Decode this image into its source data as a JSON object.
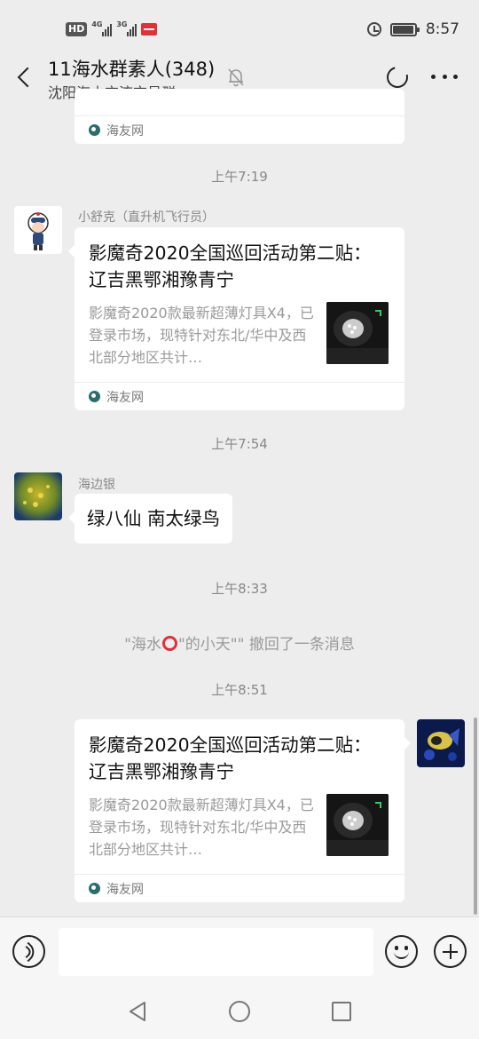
{
  "status_bar": {
    "hd": "HD",
    "net1": "4G",
    "net2": "3G",
    "time": "8:57"
  },
  "header": {
    "title": "11海水群素人(348)",
    "subtitle": "沈阳海水交流交易群"
  },
  "messages": {
    "prev_card": {
      "source": "海友网"
    },
    "ts1": "上午7:19",
    "m1": {
      "sender": "小舒克（直升机飞行员）",
      "title": "影魔奇2020全国巡回活动第二贴： 辽吉黑鄂湘豫青宁",
      "desc": "影魔奇2020款最新超薄灯具X4，已登录市场，现特针对东北/华中及西北部分地区共计…",
      "source": "海友网"
    },
    "ts2": "上午7:54",
    "m2": {
      "sender": "海边银",
      "text": "绿八仙 南太绿鸟"
    },
    "ts3": "上午8:33",
    "recall": {
      "prefix": "\"海水",
      "suffix": "\"的小天\"\" 撤回了一条消息"
    },
    "ts4": "上午8:51",
    "m3": {
      "title": "影魔奇2020全国巡回活动第二贴： 辽吉黑鄂湘豫青宁",
      "desc": "影魔奇2020款最新超薄灯具X4，已登录市场，现特针对东北/华中及西北部分地区共计…",
      "source": "海友网"
    }
  },
  "input": {
    "placeholder": ""
  },
  "colors": {
    "background": "#ededed",
    "bubble": "#ffffff",
    "muted_text": "#888888",
    "source_icon": "#2a6d6b",
    "alert_red": "#e0303a"
  },
  "icons": [
    "back-icon",
    "mute-bell-icon",
    "refresh-icon",
    "more-icon",
    "voice-icon",
    "emoji-icon",
    "plus-icon",
    "nav-back-icon",
    "nav-home-icon",
    "nav-recent-icon",
    "alarm-icon",
    "battery-icon"
  ]
}
